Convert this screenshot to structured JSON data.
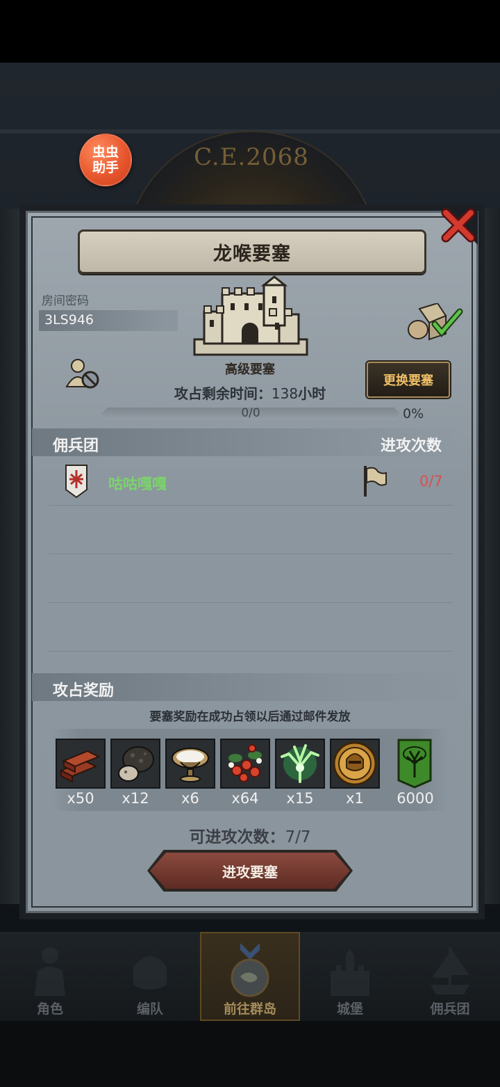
{
  "background": {
    "era_text": "C.E.2068"
  },
  "helper_badge": {
    "label": "虫虫\n助手"
  },
  "dialog": {
    "title": "龙喉要塞",
    "room": {
      "label": "房间密码",
      "code": "3LS946"
    },
    "fortress": {
      "grade": "高级要塞",
      "time_label": "攻占剩余时间：",
      "time_value": "138",
      "time_unit": "小时"
    },
    "change_button": "更换要塞",
    "progress": {
      "text": "0/0",
      "percent_text": "0%",
      "fraction": 0
    },
    "mercenary_section": {
      "title": "佣兵团",
      "right_title": "进攻次数"
    },
    "guilds": [
      {
        "name": "咕咕嘎嘎",
        "attacks": "0/7"
      }
    ],
    "reward_section": {
      "title": "攻占奖励",
      "note": "要塞奖励在成功占领以后通过邮件发放"
    },
    "rewards": [
      {
        "icon": "wood-planks-icon",
        "qty": "x50"
      },
      {
        "icon": "truffle-icon",
        "qty": "x12"
      },
      {
        "icon": "milk-bowl-icon",
        "qty": "x6"
      },
      {
        "icon": "berries-icon",
        "qty": "x64"
      },
      {
        "icon": "green-tree-spirit-icon",
        "qty": "x15"
      },
      {
        "icon": "knight-helmet-coin-icon",
        "qty": "x1"
      },
      {
        "icon": "tree-banner-icon",
        "qty": "6000"
      }
    ],
    "attacks_left": {
      "label": "可进攻次数：",
      "value": "7/7"
    },
    "attack_button": "进攻要塞"
  },
  "nav": [
    {
      "label": "角色",
      "icon": "knight-icon"
    },
    {
      "label": "编队",
      "icon": "helmet-icon"
    },
    {
      "label": "前往群岛",
      "icon": "island-icon",
      "active": true
    },
    {
      "label": "城堡",
      "icon": "castle-icon"
    },
    {
      "label": "佣兵团",
      "icon": "ship-icon"
    }
  ],
  "colors": {
    "guild_name": "#7bd46b",
    "attack_count": "#d65050",
    "change_button_text": "#f0c066"
  }
}
